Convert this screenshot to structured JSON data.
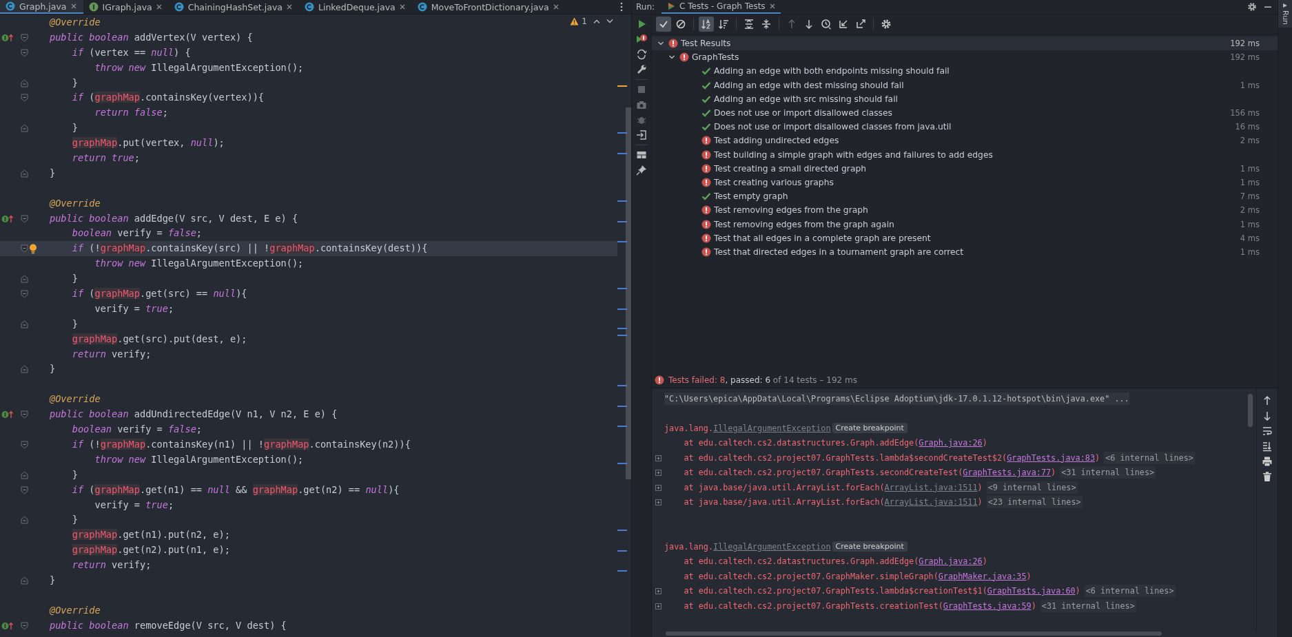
{
  "editor_tabs": [
    {
      "label": "Graph.java",
      "kind": "class",
      "selected": true
    },
    {
      "label": "IGraph.java",
      "kind": "interface",
      "selected": false
    },
    {
      "label": "ChainingHashSet.java",
      "kind": "class",
      "selected": false
    },
    {
      "label": "LinkedDeque.java",
      "kind": "class",
      "selected": false
    },
    {
      "label": "MoveToFrontDictionary.java",
      "kind": "class",
      "selected": false
    }
  ],
  "inspections": {
    "warnings": "1"
  },
  "code_blocks": [
    {
      "lines": [
        {
          "current": false,
          "tokens": [
            {
              "kind": "annotation",
              "text": "@Override"
            }
          ]
        },
        {
          "current": false,
          "marker": {
            "kind": "implements"
          },
          "fold": {
            "kind": "start"
          },
          "tokens": [
            {
              "kind": "keyword",
              "text": "public boolean "
            },
            {
              "kind": "plain",
              "text": "addVertex(V vertex) {"
            }
          ]
        },
        {
          "current": false,
          "fold": {
            "kind": "start"
          },
          "tokens": [
            {
              "kind": "keyword",
              "text": "    if"
            },
            {
              "kind": "plain",
              "text": " (vertex == "
            },
            {
              "kind": "keyword",
              "text": "null"
            },
            {
              "kind": "plain",
              "text": ") {"
            }
          ]
        },
        {
          "current": false,
          "tokens": [
            {
              "kind": "keyword",
              "text": "        throw new "
            },
            {
              "kind": "plain",
              "text": "IllegalArgumentException();"
            }
          ]
        },
        {
          "current": false,
          "fold": {
            "kind": "end"
          },
          "tokens": [
            {
              "kind": "plain",
              "text": "    }"
            }
          ]
        },
        {
          "current": false,
          "fold": {
            "kind": "start"
          },
          "tokens": [
            {
              "kind": "keyword",
              "text": "    if"
            },
            {
              "kind": "plain",
              "text": " ("
            },
            {
              "kind": "field",
              "text": "graphMap"
            },
            {
              "kind": "plain",
              "text": ".containsKey(vertex)){"
            }
          ]
        },
        {
          "current": false,
          "tokens": [
            {
              "kind": "keyword",
              "text": "        return false"
            },
            {
              "kind": "plain",
              "text": ";"
            }
          ]
        },
        {
          "current": false,
          "fold": {
            "kind": "end"
          },
          "tokens": [
            {
              "kind": "plain",
              "text": "    }"
            }
          ]
        },
        {
          "current": false,
          "tokens": [
            {
              "kind": "field",
              "text": "    graphMap"
            },
            {
              "kind": "plain",
              "text": ".put(vertex, "
            },
            {
              "kind": "keyword",
              "text": "null"
            },
            {
              "kind": "plain",
              "text": ");"
            }
          ]
        },
        {
          "current": false,
          "tokens": [
            {
              "kind": "keyword",
              "text": "    return true"
            },
            {
              "kind": "plain",
              "text": ";"
            }
          ]
        },
        {
          "current": false,
          "fold": {
            "kind": "end"
          },
          "tokens": [
            {
              "kind": "plain",
              "text": "}"
            }
          ]
        }
      ]
    },
    {
      "lines": [
        {
          "current": false,
          "tokens": [
            {
              "kind": "annotation",
              "text": "@Override"
            }
          ]
        },
        {
          "current": false,
          "marker": {
            "kind": "implements"
          },
          "fold": {
            "kind": "start"
          },
          "tokens": [
            {
              "kind": "keyword",
              "text": "public boolean "
            },
            {
              "kind": "plain",
              "text": "addEdge(V src, V dest, E e) {"
            }
          ]
        },
        {
          "current": false,
          "tokens": [
            {
              "kind": "keyword",
              "text": "    boolean "
            },
            {
              "kind": "plain",
              "text": "verify = "
            },
            {
              "kind": "keyword",
              "text": "false"
            },
            {
              "kind": "plain",
              "text": ";"
            }
          ]
        },
        {
          "current": true,
          "marker": {
            "kind": "bulb"
          },
          "fold": {
            "kind": "start"
          },
          "tokens": [
            {
              "kind": "keyword",
              "text": "    if"
            },
            {
              "kind": "plain",
              "text": " (!"
            },
            {
              "kind": "field",
              "text": "graphMap"
            },
            {
              "kind": "plain",
              "text": ".containsKey(src) || !"
            },
            {
              "kind": "field",
              "text": "graphMap"
            },
            {
              "kind": "plain",
              "text": ".containsKey(dest)){"
            }
          ]
        },
        {
          "current": false,
          "tokens": [
            {
              "kind": "keyword",
              "text": "        throw new "
            },
            {
              "kind": "plain",
              "text": "IllegalArgumentException();"
            }
          ]
        },
        {
          "current": false,
          "fold": {
            "kind": "end"
          },
          "tokens": [
            {
              "kind": "plain",
              "text": "    }"
            }
          ]
        },
        {
          "current": false,
          "fold": {
            "kind": "start"
          },
          "tokens": [
            {
              "kind": "keyword",
              "text": "    if"
            },
            {
              "kind": "plain",
              "text": " ("
            },
            {
              "kind": "field",
              "text": "graphMap"
            },
            {
              "kind": "plain",
              "text": ".get(src) == "
            },
            {
              "kind": "keyword",
              "text": "null"
            },
            {
              "kind": "plain",
              "text": "){"
            }
          ]
        },
        {
          "current": false,
          "tokens": [
            {
              "kind": "plain",
              "text": "        verify = "
            },
            {
              "kind": "keyword",
              "text": "true"
            },
            {
              "kind": "plain",
              "text": ";"
            }
          ]
        },
        {
          "current": false,
          "fold": {
            "kind": "end"
          },
          "tokens": [
            {
              "kind": "plain",
              "text": "    }"
            }
          ]
        },
        {
          "current": false,
          "tokens": [
            {
              "kind": "field",
              "text": "    graphMap"
            },
            {
              "kind": "plain",
              "text": ".get(src).put(dest, e);"
            }
          ]
        },
        {
          "current": false,
          "tokens": [
            {
              "kind": "keyword",
              "text": "    return "
            },
            {
              "kind": "plain",
              "text": "verify;"
            }
          ]
        },
        {
          "current": false,
          "fold": {
            "kind": "end"
          },
          "tokens": [
            {
              "kind": "plain",
              "text": "}"
            }
          ]
        }
      ]
    },
    {
      "lines": [
        {
          "current": false,
          "tokens": [
            {
              "kind": "annotation",
              "text": "@Override"
            }
          ]
        },
        {
          "current": false,
          "marker": {
            "kind": "implements"
          },
          "fold": {
            "kind": "start"
          },
          "tokens": [
            {
              "kind": "keyword",
              "text": "public boolean "
            },
            {
              "kind": "plain",
              "text": "addUndirectedEdge(V n1, V n2, E e) {"
            }
          ]
        },
        {
          "current": false,
          "tokens": [
            {
              "kind": "keyword",
              "text": "    boolean "
            },
            {
              "kind": "plain",
              "text": "verify = "
            },
            {
              "kind": "keyword",
              "text": "false"
            },
            {
              "kind": "plain",
              "text": ";"
            }
          ]
        },
        {
          "current": false,
          "fold": {
            "kind": "start"
          },
          "tokens": [
            {
              "kind": "keyword",
              "text": "    if"
            },
            {
              "kind": "plain",
              "text": " (!"
            },
            {
              "kind": "field",
              "text": "graphMap"
            },
            {
              "kind": "plain",
              "text": ".containsKey(n1) || !"
            },
            {
              "kind": "field",
              "text": "graphMap"
            },
            {
              "kind": "plain",
              "text": ".containsKey(n2)){"
            }
          ]
        },
        {
          "current": false,
          "tokens": [
            {
              "kind": "keyword",
              "text": "        throw new "
            },
            {
              "kind": "plain",
              "text": "IllegalArgumentException();"
            }
          ]
        },
        {
          "current": false,
          "fold": {
            "kind": "end"
          },
          "tokens": [
            {
              "kind": "plain",
              "text": "    }"
            }
          ]
        },
        {
          "current": false,
          "fold": {
            "kind": "start"
          },
          "tokens": [
            {
              "kind": "keyword",
              "text": "    if"
            },
            {
              "kind": "plain",
              "text": " ("
            },
            {
              "kind": "field",
              "text": "graphMap"
            },
            {
              "kind": "plain",
              "text": ".get(n1) == "
            },
            {
              "kind": "keyword",
              "text": "null"
            },
            {
              "kind": "plain",
              "text": " && "
            },
            {
              "kind": "field",
              "text": "graphMap"
            },
            {
              "kind": "plain",
              "text": ".get(n2) == "
            },
            {
              "kind": "keyword",
              "text": "null"
            },
            {
              "kind": "plain",
              "text": "){"
            }
          ]
        },
        {
          "current": false,
          "tokens": [
            {
              "kind": "plain",
              "text": "        verify = "
            },
            {
              "kind": "keyword",
              "text": "true"
            },
            {
              "kind": "plain",
              "text": ";"
            }
          ]
        },
        {
          "current": false,
          "fold": {
            "kind": "end"
          },
          "tokens": [
            {
              "kind": "plain",
              "text": "    }"
            }
          ]
        },
        {
          "current": false,
          "tokens": [
            {
              "kind": "field",
              "text": "    graphMap"
            },
            {
              "kind": "plain",
              "text": ".get(n1).put(n2, e);"
            }
          ]
        },
        {
          "current": false,
          "tokens": [
            {
              "kind": "field",
              "text": "    graphMap"
            },
            {
              "kind": "plain",
              "text": ".get(n2).put(n1, e);"
            }
          ]
        },
        {
          "current": false,
          "tokens": [
            {
              "kind": "keyword",
              "text": "    return "
            },
            {
              "kind": "plain",
              "text": "verify;"
            }
          ]
        },
        {
          "current": false,
          "fold": {
            "kind": "end"
          },
          "tokens": [
            {
              "kind": "plain",
              "text": "}"
            }
          ]
        }
      ]
    },
    {
      "lines": [
        {
          "current": false,
          "tokens": [
            {
              "kind": "annotation",
              "text": "@Override"
            }
          ]
        },
        {
          "current": false,
          "marker": {
            "kind": "implements"
          },
          "fold": {
            "kind": "start"
          },
          "tokens": [
            {
              "kind": "keyword",
              "text": "public boolean "
            },
            {
              "kind": "plain",
              "text": "removeEdge(V src, V dest) {"
            }
          ]
        }
      ]
    }
  ],
  "run_panel": {
    "label": "Run:",
    "tab": {
      "label": "C Tests - Graph Tests",
      "selected": true
    },
    "toolbar": [
      {
        "kind": "show-passed",
        "selected": true,
        "disabled": false
      },
      {
        "kind": "show-ignored",
        "selected": false,
        "disabled": false
      },
      {
        "kind": "sort-alpha",
        "selected": true,
        "disabled": false
      },
      {
        "kind": "sort-duration",
        "selected": false,
        "disabled": false
      },
      {
        "kind": "expand-all",
        "selected": false,
        "disabled": false
      },
      {
        "kind": "collapse-all",
        "selected": false,
        "disabled": false
      },
      {
        "kind": "prev-failed",
        "selected": false,
        "disabled": true
      },
      {
        "kind": "next-failed",
        "selected": false,
        "disabled": false
      },
      {
        "kind": "history",
        "selected": false,
        "disabled": false
      },
      {
        "kind": "import",
        "selected": false,
        "disabled": false
      },
      {
        "kind": "export",
        "selected": false,
        "disabled": false
      },
      {
        "kind": "settings",
        "selected": false,
        "disabled": false
      }
    ],
    "tree": [
      {
        "label": "Test Results",
        "kind": "failed",
        "time": "192 ms",
        "expanded": true,
        "children": [
          {
            "label": "GraphTests",
            "kind": "failed",
            "time": "192 ms",
            "expanded": true,
            "children": [
              {
                "label": "Adding an edge with both endpoints missing should fail",
                "kind": "passed"
              },
              {
                "label": "Adding an edge with dest missing should fail",
                "kind": "passed",
                "time": "1 ms"
              },
              {
                "label": "Adding an edge with src missing should fail",
                "kind": "passed"
              },
              {
                "label": "Does not use or import disallowed classes",
                "kind": "passed",
                "time": "156 ms"
              },
              {
                "label": "Does not use or import disallowed classes from java.util",
                "kind": "passed",
                "time": "16 ms"
              },
              {
                "label": "Test adding undirected edges",
                "kind": "failed",
                "time": "2 ms"
              },
              {
                "label": "Test building a simple graph with edges and failures to add edges",
                "kind": "failed"
              },
              {
                "label": "Test creating a small directed graph",
                "kind": "failed",
                "time": "1 ms"
              },
              {
                "label": "Test creating various graphs",
                "kind": "failed",
                "time": "1 ms"
              },
              {
                "label": "Test empty graph",
                "kind": "passed",
                "time": "7 ms"
              },
              {
                "label": "Test removing edges from the graph",
                "kind": "failed",
                "time": "2 ms"
              },
              {
                "label": "Test removing edges from the graph again",
                "kind": "failed",
                "time": "1 ms"
              },
              {
                "label": "Test that all edges in a complete graph are present",
                "kind": "failed",
                "time": "4 ms"
              },
              {
                "label": "Test that directed edges in a tournament graph are correct",
                "kind": "failed",
                "time": "1 ms"
              }
            ]
          }
        ]
      }
    ],
    "summary": {
      "failed": "Tests failed: 8",
      "passed": ", passed: 6",
      "rest": " of 14 tests – 192 ms"
    },
    "console": [
      {
        "kind": "command",
        "text": "\"C:\\Users\\epica\\AppData\\Local\\Programs\\Eclipse Adoptium\\jdk-17.0.1.12-hotspot\\bin\\java.exe\" ..."
      },
      {
        "kind": "blank"
      },
      {
        "kind": "exception",
        "prefix": "java.lang.",
        "link": "IllegalArgumentException",
        "button": "Create breakpoint"
      },
      {
        "kind": "at",
        "foldable": false,
        "prefix": "    at edu.caltech.cs2.datastructures.Graph.addEdge(",
        "link": "Graph.java:26",
        "library": false,
        "suffix": ")"
      },
      {
        "kind": "at",
        "foldable": true,
        "prefix": "    at edu.caltech.cs2.project07.GraphTests.lambda$secondCreateTest$2(",
        "link": "GraphTests.java:83",
        "library": false,
        "suffix": ")",
        "internal": "<6 internal lines>"
      },
      {
        "kind": "at",
        "foldable": true,
        "prefix": "    at edu.caltech.cs2.project07.GraphTests.secondCreateTest(",
        "link": "GraphTests.java:77",
        "library": false,
        "suffix": ")",
        "internal": "<31 internal lines>"
      },
      {
        "kind": "at",
        "foldable": true,
        "prefix": "    at java.base/java.util.ArrayList.forEach(",
        "link": "ArrayList.java:1511",
        "library": true,
        "suffix": ")",
        "internal": "<9 internal lines>"
      },
      {
        "kind": "at",
        "foldable": true,
        "prefix": "    at java.base/java.util.ArrayList.forEach(",
        "link": "ArrayList.java:1511",
        "library": true,
        "suffix": ")",
        "internal": "<23 internal lines>"
      },
      {
        "kind": "blank"
      },
      {
        "kind": "blank"
      },
      {
        "kind": "exception",
        "prefix": "java.lang.",
        "link": "IllegalArgumentException",
        "button": "Create breakpoint"
      },
      {
        "kind": "at",
        "foldable": false,
        "prefix": "    at edu.caltech.cs2.datastructures.Graph.addEdge(",
        "link": "Graph.java:26",
        "library": false,
        "suffix": ")"
      },
      {
        "kind": "at",
        "foldable": false,
        "prefix": "    at edu.caltech.cs2.project07.GraphMaker.simpleGraph(",
        "link": "GraphMaker.java:35",
        "library": false,
        "suffix": ")"
      },
      {
        "kind": "at",
        "foldable": true,
        "prefix": "    at edu.caltech.cs2.project07.GraphTests.lambda$creationTest$1(",
        "link": "GraphTests.java:60",
        "library": false,
        "suffix": ")",
        "internal": "<6 internal lines>"
      },
      {
        "kind": "at",
        "foldable": true,
        "prefix": "    at edu.caltech.cs2.project07.GraphTests.creationTest(",
        "link": "GraphTests.java:59",
        "library": false,
        "suffix": ")",
        "internal": "<31 internal lines>"
      }
    ]
  },
  "side_strip": {
    "label": "Run"
  }
}
